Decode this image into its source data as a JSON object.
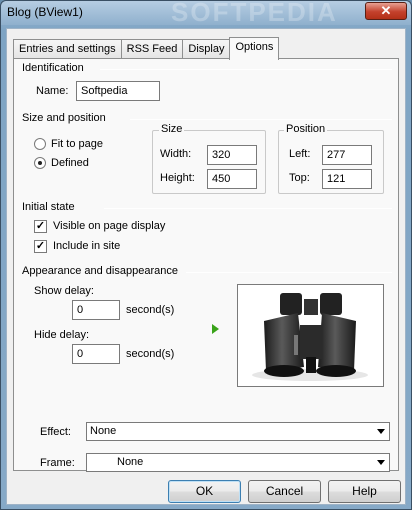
{
  "window": {
    "title": "Blog (BView1)",
    "watermark": "SOFTPEDIA",
    "close_glyph": "✕"
  },
  "tabs": [
    {
      "label": "Entries and settings",
      "active": false
    },
    {
      "label": "RSS Feed",
      "active": false
    },
    {
      "label": "Display",
      "active": false
    },
    {
      "label": "Options",
      "active": true
    }
  ],
  "identification": {
    "heading": "Identification",
    "name_label": "Name:",
    "name_value": "Softpedia"
  },
  "size_position": {
    "heading": "Size and position",
    "fit_to_page": "Fit to page",
    "defined": "Defined",
    "selected": "Defined",
    "size_title": "Size",
    "width_label": "Width:",
    "width_value": "320",
    "height_label": "Height:",
    "height_value": "450",
    "position_title": "Position",
    "left_label": "Left:",
    "left_value": "277",
    "top_label": "Top:",
    "top_value": "121"
  },
  "initial_state": {
    "heading": "Initial state",
    "visible_label": "Visible on page display",
    "visible_checked": true,
    "include_label": "Include in site",
    "include_checked": true,
    "check_glyph": "✓"
  },
  "appearance": {
    "heading": "Appearance and disappearance",
    "show_delay_label": "Show delay:",
    "show_delay_value": "0",
    "hide_delay_label": "Hide delay:",
    "hide_delay_value": "0",
    "unit": "second(s)",
    "effect_label": "Effect:",
    "effect_value": "None",
    "frame_label": "Frame:",
    "frame_value": "None"
  },
  "buttons": {
    "ok": "OK",
    "cancel": "Cancel",
    "help": "Help"
  },
  "colors": {
    "accent_play": "#3aa31a",
    "titlebar": "#8fb0cd"
  }
}
